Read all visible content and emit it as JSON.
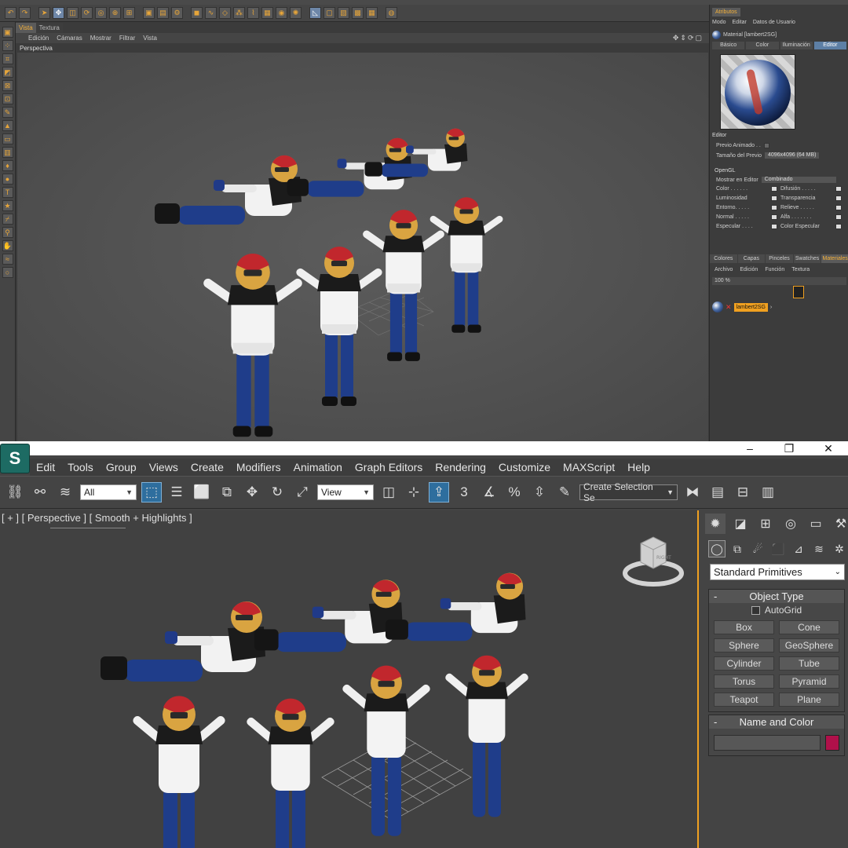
{
  "c4d": {
    "view_tabs": [
      "Vista",
      "Textura"
    ],
    "view_menu": [
      "Edición",
      "Cámaras",
      "Mostrar",
      "Filtrar",
      "Vista"
    ],
    "viewport_label": "Perspectiva",
    "attributes": {
      "tab": "Atributos",
      "menu": [
        "Modo",
        "Editar",
        "Datos de Usuario"
      ],
      "material_name": "Material [lambert2SG]",
      "subtabs": [
        "Básico",
        "Color",
        "Iluminación",
        "Editor"
      ],
      "active_subtab": "Editor",
      "section_editor": "Editor",
      "previo_animado": "Previo Animado . .",
      "tamano_previo_label": "Tamaño del Previo",
      "tamano_previo_value": "4096x4096 (64 MB)",
      "section_opengl": "OpenGL",
      "mostrar_en_editor_label": "Mostrar en Editor",
      "mostrar_en_editor_value": "Combinado",
      "channels": [
        "Color . . . . . .",
        "Difusión . . . . .",
        "Luminosidad",
        "Transparencia",
        "Entorno. . . . .",
        "Relieve . . . . .",
        "Normal . . . . .",
        "Alfa . . . . . . .",
        "Especular . . . .",
        "Color Especular"
      ]
    },
    "materials": {
      "tabs": [
        "Colores",
        "Capas",
        "Pinceles",
        "Swatches",
        "Materiales"
      ],
      "active_tab": "Materiales",
      "menu": [
        "Archivo",
        "Edición",
        "Función",
        "Textura"
      ],
      "zoom": "100 %",
      "material_chip": "lambert2SG"
    },
    "colors": {
      "accent": "#f5b13a",
      "tab_active_blue": "#5d7fa5"
    }
  },
  "max": {
    "window_buttons": [
      "–",
      "❐",
      "✕"
    ],
    "menu": [
      "Edit",
      "Tools",
      "Group",
      "Views",
      "Create",
      "Modifiers",
      "Animation",
      "Graph Editors",
      "Rendering",
      "Customize",
      "MAXScript",
      "Help"
    ],
    "filter_dropdown": "All",
    "coord_dropdown": "View",
    "selection_set_placeholder": "Create Selection Se",
    "snap_label": "3",
    "viewport_label": "[ + ] [ Perspective ] [ Smooth + Highlights ]",
    "viewcube_label": "RIGHT",
    "command_panel": {
      "category_dropdown": "Standard Primitives",
      "object_type_title": "Object Type",
      "autogrid_label": "AutoGrid",
      "primitives": [
        "Box",
        "Cone",
        "Sphere",
        "GeoSphere",
        "Cylinder",
        "Tube",
        "Torus",
        "Pyramid",
        "Teapot",
        "Plane"
      ],
      "name_color_title": "Name and Color",
      "object_color": "#b0104a"
    },
    "colors": {
      "viewport_border": "#f0a020",
      "active_tool": "#2e6e9e"
    }
  }
}
